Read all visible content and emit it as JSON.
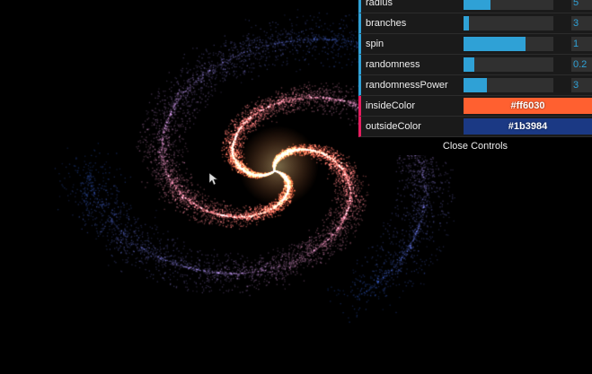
{
  "gui": {
    "controls": [
      {
        "label": "radius",
        "value": "5",
        "fill": 0.3
      },
      {
        "label": "branches",
        "value": "3",
        "fill": 0.06
      },
      {
        "label": "spin",
        "value": "1",
        "fill": 0.69
      },
      {
        "label": "randomness",
        "value": "0.2",
        "fill": 0.12
      },
      {
        "label": "randomnessPower",
        "value": "3",
        "fill": 0.26
      }
    ],
    "inside_color": {
      "label": "insideColor",
      "value": "#ff6030"
    },
    "outside_color": {
      "label": "outsideColor",
      "value": "#1b3984"
    },
    "close_label": "Close Controls"
  },
  "colors": {
    "background": "#000000",
    "slider_accent": "#2fa1d6",
    "color_row_accent": "#e61d5f",
    "galaxy_inside": "#ff6030",
    "galaxy_outside": "#1b3984"
  },
  "galaxy": {
    "branches": 3,
    "spin": 1,
    "randomness": 0.2,
    "randomnessPower": 3,
    "radius": 5
  }
}
